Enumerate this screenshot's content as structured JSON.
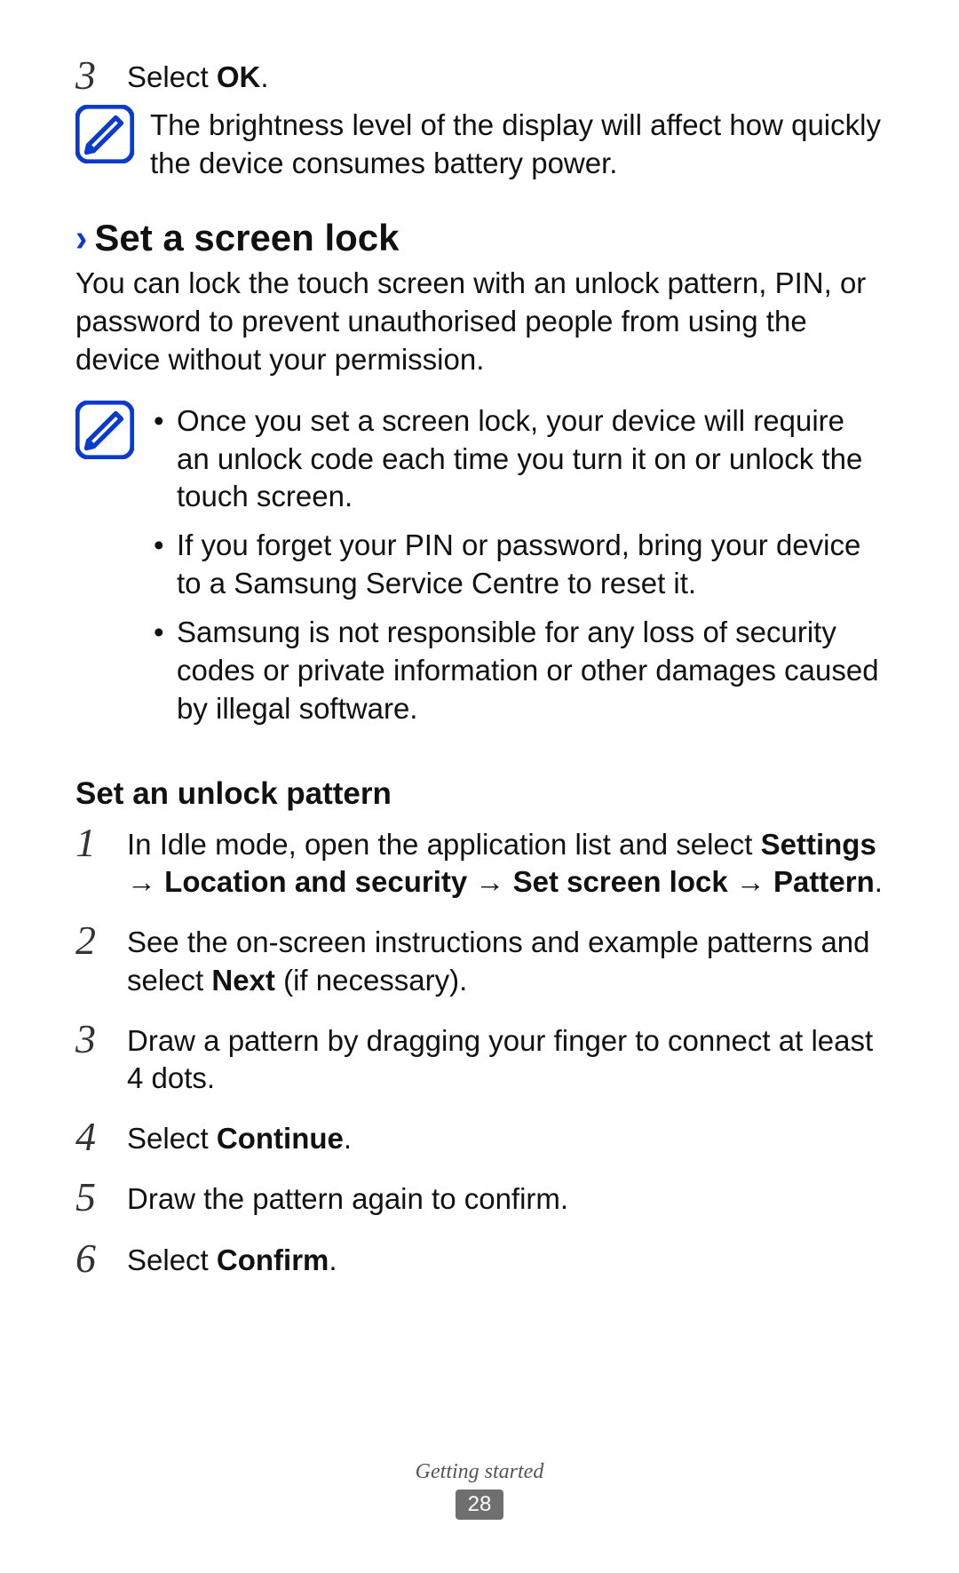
{
  "prev_step": {
    "number": "3",
    "prefix": "Select ",
    "bold": "OK",
    "suffix": "."
  },
  "note1": {
    "text": "The brightness level of the display will affect how quickly the device consumes battery power."
  },
  "section": {
    "title": "Set a screen lock",
    "intro": "You can lock the touch screen with an unlock pattern, PIN, or password to prevent unauthorised people from using the device without your permission."
  },
  "note2": {
    "bullets": [
      "Once you set a screen lock, your device will require an unlock code each time you turn it on or unlock the touch screen.",
      "If you forget your PIN or password, bring your device to a Samsung Service Centre to reset it.",
      "Samsung is not responsible for any loss of security codes or private information or other damages caused by illegal software."
    ]
  },
  "sub_heading": "Set an unlock pattern",
  "steps": [
    {
      "number": "1",
      "pre": "In Idle mode, open the application list and select ",
      "bold": "Settings → Location and security → Set screen lock → Pattern",
      "post": "."
    },
    {
      "number": "2",
      "pre": "See the on-screen instructions and example patterns and select ",
      "bold": "Next",
      "post": " (if necessary)."
    },
    {
      "number": "3",
      "pre": "Draw a pattern by dragging your finger to connect at least 4 dots.",
      "bold": "",
      "post": ""
    },
    {
      "number": "4",
      "pre": "Select ",
      "bold": "Continue",
      "post": "."
    },
    {
      "number": "5",
      "pre": "Draw the pattern again to confirm.",
      "bold": "",
      "post": ""
    },
    {
      "number": "6",
      "pre": "Select ",
      "bold": "Confirm",
      "post": "."
    }
  ],
  "footer": {
    "label": "Getting started",
    "page": "28"
  }
}
